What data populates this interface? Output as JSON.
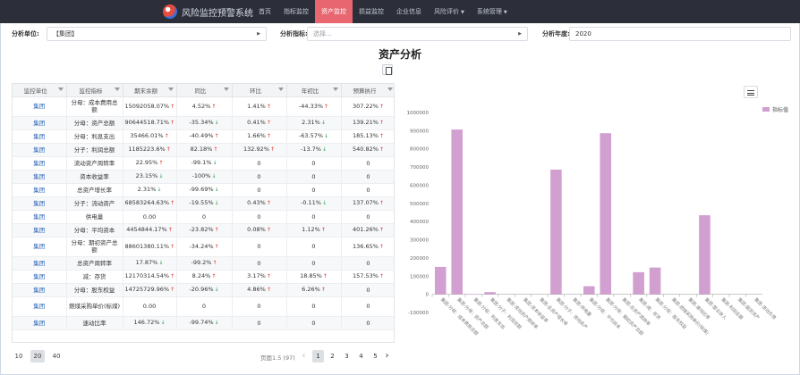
{
  "app": {
    "title": "风险监控预警系统"
  },
  "nav": [
    {
      "label": "首页",
      "active": false,
      "dropdown": false
    },
    {
      "label": "指标监控",
      "active": false,
      "dropdown": false
    },
    {
      "label": "资产监控",
      "active": true,
      "dropdown": false
    },
    {
      "label": "损益监控",
      "active": false,
      "dropdown": false
    },
    {
      "label": "企业信息",
      "active": false,
      "dropdown": false
    },
    {
      "label": "风险评价",
      "active": false,
      "dropdown": true
    },
    {
      "label": "系统管理",
      "active": false,
      "dropdown": true
    }
  ],
  "filters": {
    "unit_label": "分析单位:",
    "unit_value": "【集团】",
    "metric_label": "分析指标:",
    "metric_placeholder": "选择...",
    "year_label": "分析年度:",
    "year_value": "2020"
  },
  "page_title": "资产分析",
  "table": {
    "headers": [
      "监控单位",
      "监控指标",
      "期末余额",
      "同比",
      "环比",
      "年初比",
      "预算执行"
    ],
    "rows": [
      {
        "unit": "集团",
        "metric": "分母：成本费用总额",
        "balance": "15092058.07%",
        "balance_dir": "up",
        "yoy": "4.52%",
        "yoy_dir": "up",
        "mom": "1.41%",
        "mom_dir": "up",
        "ytd": "-44.33%",
        "ytd_dir": "up",
        "budget": "307.22%",
        "budget_dir": "up"
      },
      {
        "unit": "集团",
        "metric": "分母：资产总额",
        "balance": "90644518.71%",
        "balance_dir": "up",
        "yoy": "-35.34%",
        "yoy_dir": "down",
        "mom": "0.41%",
        "mom_dir": "up",
        "ytd": "2.31%",
        "ytd_dir": "down",
        "budget": "139.21%",
        "budget_dir": "up"
      },
      {
        "unit": "集团",
        "metric": "分母：利息支出",
        "balance": "35466.01%",
        "balance_dir": "up",
        "yoy": "-40.49%",
        "yoy_dir": "up",
        "mom": "1.66%",
        "mom_dir": "up",
        "ytd": "-63.57%",
        "ytd_dir": "down",
        "budget": "185.13%",
        "budget_dir": "up"
      },
      {
        "unit": "集团",
        "metric": "分子：利润总额",
        "balance": "1185223.6%",
        "balance_dir": "up",
        "yoy": "82.18%",
        "yoy_dir": "up",
        "mom": "132.92%",
        "mom_dir": "up",
        "ytd": "-13.7%",
        "ytd_dir": "down",
        "budget": "540.82%",
        "budget_dir": "up"
      },
      {
        "unit": "集团",
        "metric": "流动资产周转率",
        "balance": "22.95%",
        "balance_dir": "up",
        "yoy": "-99.1%",
        "yoy_dir": "down",
        "mom": "0",
        "mom_dir": "",
        "ytd": "0",
        "ytd_dir": "",
        "budget": "0",
        "budget_dir": ""
      },
      {
        "unit": "集团",
        "metric": "资本收益率",
        "balance": "23.15%",
        "balance_dir": "down",
        "yoy": "-100%",
        "yoy_dir": "down",
        "mom": "0",
        "mom_dir": "",
        "ytd": "0",
        "ytd_dir": "",
        "budget": "0",
        "budget_dir": ""
      },
      {
        "unit": "集团",
        "metric": "总资产增长率",
        "balance": "2.31%",
        "balance_dir": "down",
        "yoy": "-99.69%",
        "yoy_dir": "down",
        "mom": "0",
        "mom_dir": "",
        "ytd": "0",
        "ytd_dir": "",
        "budget": "0",
        "budget_dir": ""
      },
      {
        "unit": "集团",
        "metric": "分子：流动资产",
        "balance": "68583264.63%",
        "balance_dir": "up",
        "yoy": "-19.55%",
        "yoy_dir": "down",
        "mom": "0.43%",
        "mom_dir": "up",
        "ytd": "-0.11%",
        "ytd_dir": "down",
        "budget": "137.07%",
        "budget_dir": "up"
      },
      {
        "unit": "集团",
        "metric": "供电量",
        "balance": "0.00",
        "balance_dir": "",
        "yoy": "0",
        "yoy_dir": "",
        "mom": "0",
        "mom_dir": "",
        "ytd": "0",
        "ytd_dir": "",
        "budget": "0",
        "budget_dir": ""
      },
      {
        "unit": "集团",
        "metric": "分母：平均资本",
        "balance": "4454844.17%",
        "balance_dir": "up",
        "yoy": "-23.82%",
        "yoy_dir": "up",
        "mom": "0.08%",
        "mom_dir": "up",
        "ytd": "1.12%",
        "ytd_dir": "up",
        "budget": "401.26%",
        "budget_dir": "up"
      },
      {
        "unit": "集团",
        "metric": "分母：期初资产总额",
        "balance": "88601380.11%",
        "balance_dir": "up",
        "yoy": "-34.24%",
        "yoy_dir": "up",
        "mom": "0",
        "mom_dir": "",
        "ytd": "0",
        "ytd_dir": "",
        "budget": "136.65%",
        "budget_dir": "up"
      },
      {
        "unit": "集团",
        "metric": "总资产周转率",
        "balance": "17.87%",
        "balance_dir": "down",
        "yoy": "-99.2%",
        "yoy_dir": "up",
        "mom": "0",
        "mom_dir": "",
        "ytd": "0",
        "ytd_dir": "",
        "budget": "0",
        "budget_dir": ""
      },
      {
        "unit": "集团",
        "metric": "减：存货",
        "balance": "12170314.54%",
        "balance_dir": "up",
        "yoy": "8.24%",
        "yoy_dir": "up",
        "mom": "3.17%",
        "mom_dir": "up",
        "ytd": "18.85%",
        "ytd_dir": "up",
        "budget": "157.53%",
        "budget_dir": "up"
      },
      {
        "unit": "集团",
        "metric": "分母：股东权益",
        "balance": "14725729.96%",
        "balance_dir": "up",
        "yoy": "-20.96%",
        "yoy_dir": "down",
        "mom": "4.86%",
        "mom_dir": "up",
        "ytd": "6.26%",
        "ytd_dir": "up",
        "budget": "0",
        "budget_dir": ""
      },
      {
        "unit": "集团",
        "metric": "燃煤采购单价(标煤)",
        "balance": "0.00",
        "balance_dir": "",
        "yoy": "0",
        "yoy_dir": "",
        "mom": "0",
        "mom_dir": "",
        "ytd": "0",
        "ytd_dir": "",
        "budget": "0",
        "budget_dir": ""
      },
      {
        "unit": "集团",
        "metric": "速动比率",
        "balance": "146.72%",
        "balance_dir": "down",
        "yoy": "-99.74%",
        "yoy_dir": "down",
        "mom": "0",
        "mom_dir": "",
        "ytd": "0",
        "ytd_dir": "",
        "budget": "0",
        "budget_dir": ""
      }
    ]
  },
  "pagination": {
    "page_sizes": [
      "10",
      "20",
      "40"
    ],
    "active_size": "20",
    "info": "页面1.5 (97)",
    "pages": [
      "1",
      "2",
      "3",
      "4",
      "5"
    ],
    "active_page": "1",
    "prev_icon": "chevron-left-icon",
    "next_icon": "chevron-right-icon"
  },
  "chart_data": {
    "type": "bar",
    "legend": [
      "指标值"
    ],
    "legend_position": "top-right",
    "ylim": [
      -100000,
      1000000
    ],
    "yticks": [
      -100000,
      0,
      100000,
      200000,
      300000,
      400000,
      500000,
      600000,
      700000,
      800000,
      900000,
      1000000
    ],
    "grid": false,
    "color": "#d19fd0",
    "categories": [
      "集团-分母：成本费用总额",
      "集团-分母：资产总额",
      "集团-分母：利息支出",
      "集团-分子：利润总额",
      "集团-流动资产周转率",
      "集团-资本收益率",
      "集团-总资产增长率",
      "集团-分子：流动资产",
      "集团-供电量",
      "集团-分母：平均资本",
      "集团-分母：期初资产总额",
      "集团-总资产周转率",
      "集团-减：存货",
      "集团-分母：股东权益",
      "集团-燃煤采购单价(标煤)",
      "集团-速动比率",
      "集团-营业收入",
      "集团-利润总额",
      "集团-固定资产",
      "集团-流动负债"
    ],
    "values": [
      150920,
      906445,
      355,
      11852,
      0,
      0,
      0,
      685833,
      0,
      44548,
      886014,
      0,
      121703,
      147257,
      0,
      0,
      435000,
      0,
      0,
      0
    ]
  }
}
